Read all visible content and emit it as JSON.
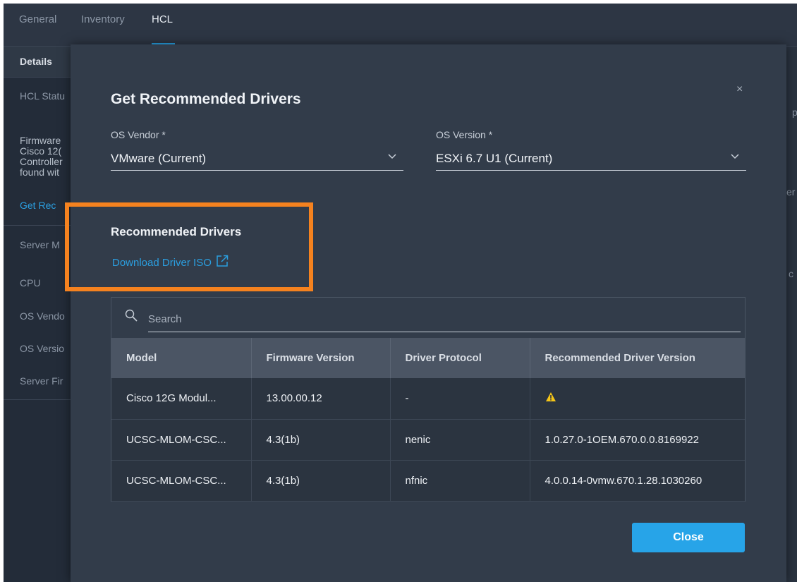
{
  "tabs": [
    {
      "label": "General"
    },
    {
      "label": "Inventory"
    },
    {
      "label": "HCL"
    }
  ],
  "sidebar": {
    "details": "Details",
    "hcl_status": "HCL Statu",
    "firmware_lines": [
      "Firmware",
      "Cisco 12(",
      "Controller",
      "found wit"
    ],
    "get_recommended": "Get Rec",
    "server_model": "Server M",
    "cpu": "CPU",
    "os_vendor": "OS Vendo",
    "os_version": "OS Versio",
    "server_firmware": "Server Fir"
  },
  "right_edge": {
    "c1": "p",
    "c2": "er",
    "c3": "c"
  },
  "modal": {
    "title": "Get Recommended Drivers",
    "close_icon": "×",
    "os_vendor": {
      "label": "OS Vendor *",
      "value": "VMware (Current)"
    },
    "os_version": {
      "label": "OS Version *",
      "value": "ESXi 6.7 U1 (Current)"
    },
    "recommended_title": "Recommended Drivers",
    "download_link": "Download Driver ISO",
    "search_placeholder": "Search",
    "table": {
      "headers": [
        "Model",
        "Firmware Version",
        "Driver Protocol",
        "Recommended Driver Version"
      ],
      "rows": [
        [
          "Cisco 12G Modul...",
          "13.00.00.12",
          "-",
          "⚠"
        ],
        [
          "UCSC-MLOM-CSC...",
          "4.3(1b)",
          "nenic",
          "1.0.27.0-1OEM.670.0.0.8169922"
        ],
        [
          "UCSC-MLOM-CSC...",
          "4.3(1b)",
          "nfnic",
          "4.0.0.14-0vmw.670.1.28.1030260"
        ]
      ]
    },
    "close_button": "Close"
  },
  "colors": {
    "accent": "#27a4e8",
    "highlight": "#f5821f",
    "warning": "#f5c518"
  }
}
